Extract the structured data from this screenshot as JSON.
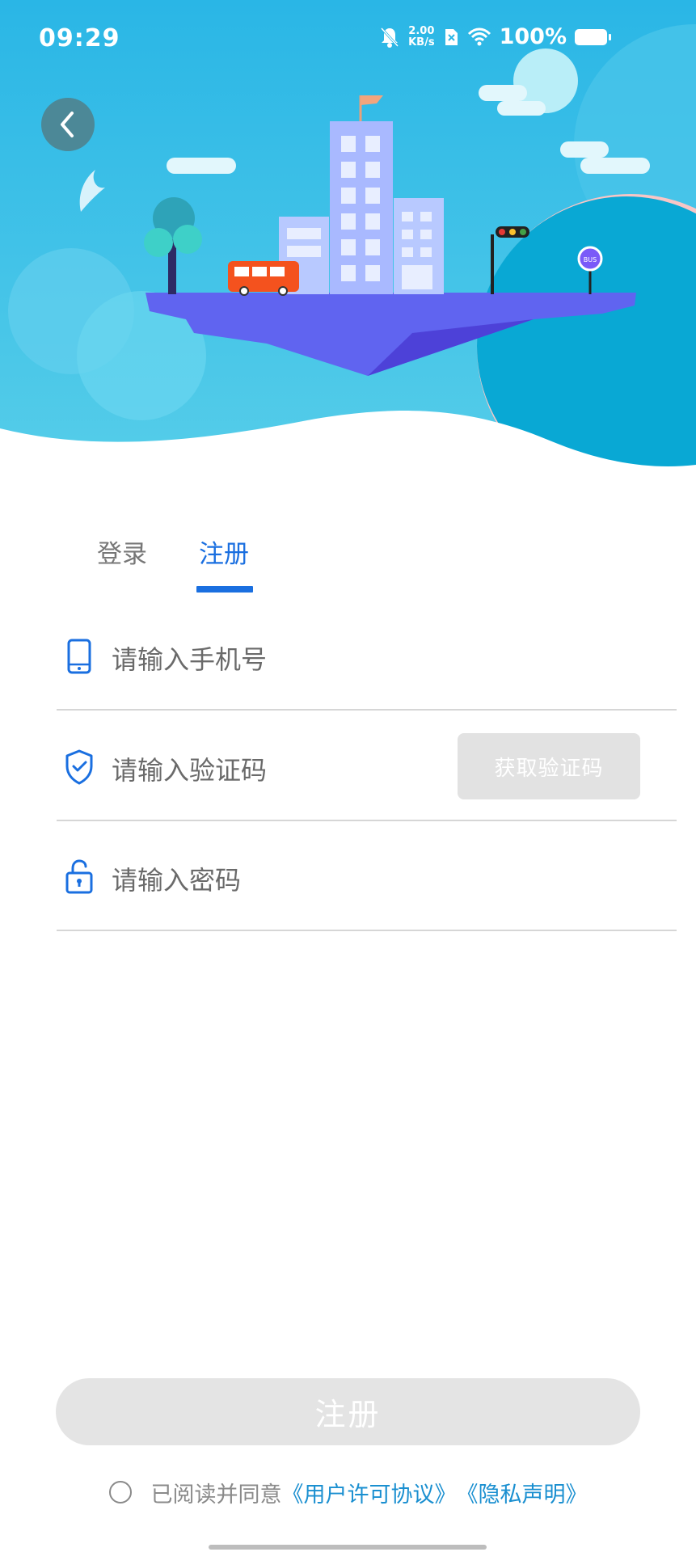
{
  "status_bar": {
    "time": "09:29",
    "speed_value": "2.00",
    "speed_unit": "KB/s",
    "battery": "100%"
  },
  "tabs": {
    "login": "登录",
    "register": "注册",
    "active": "register"
  },
  "form": {
    "phone_placeholder": "请输入手机号",
    "code_placeholder": "请输入验证码",
    "get_code_label": "获取验证码",
    "password_placeholder": "请输入密码"
  },
  "submit_label": "注册",
  "agreement": {
    "prefix": "已阅读并同意",
    "license_link": "《用户许可协议》",
    "privacy_link": "《隐私声明》",
    "checked": false
  },
  "colors": {
    "accent": "#1a6fe0",
    "sky": "#2bb8e4",
    "disabled": "#e4e4e4",
    "link": "#1a8fd0"
  }
}
